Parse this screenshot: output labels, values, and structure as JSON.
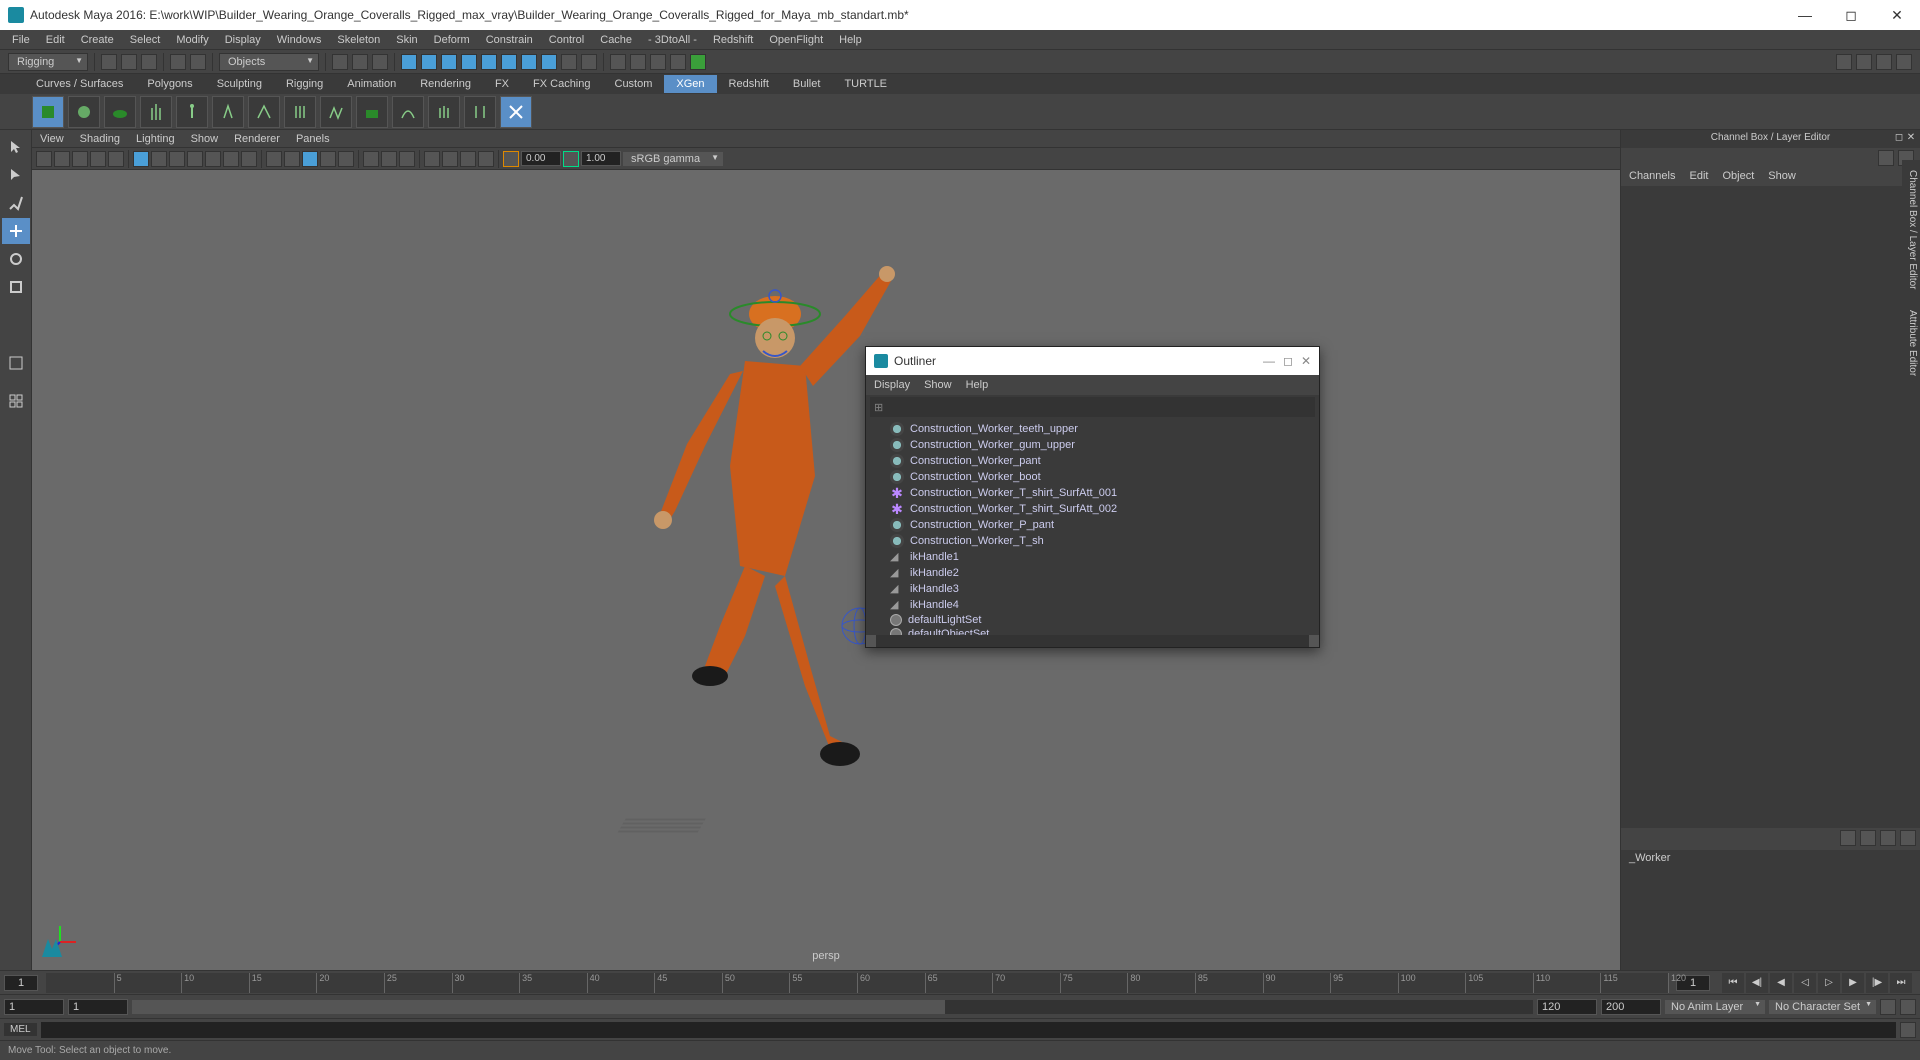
{
  "titlebar": {
    "app_name": "Autodesk Maya 2016:",
    "file_path": "E:\\work\\WIP\\Builder_Wearing_Orange_Coveralls_Rigged_max_vray\\Builder_Wearing_Orange_Coveralls_Rigged_for_Maya_mb_standart.mb*"
  },
  "menubar": {
    "items": [
      "File",
      "Edit",
      "Create",
      "Select",
      "Modify",
      "Display",
      "Windows",
      "Skeleton",
      "Skin",
      "Deform",
      "Constrain",
      "Control",
      "Cache",
      "- 3DtoAll -",
      "Redshift",
      "OpenFlight",
      "Help"
    ]
  },
  "status_toolbar": {
    "mode_dropdown": "Rigging",
    "objects_dropdown": "Objects"
  },
  "shelf_tabs": {
    "tabs": [
      "Curves / Surfaces",
      "Polygons",
      "Sculpting",
      "Rigging",
      "Animation",
      "Rendering",
      "FX",
      "FX Caching",
      "Custom",
      "XGen",
      "Redshift",
      "Bullet",
      "TURTLE"
    ],
    "active": "XGen"
  },
  "view_menubar": {
    "items": [
      "View",
      "Shading",
      "Lighting",
      "Show",
      "Renderer",
      "Panels"
    ]
  },
  "view_toolbar": {
    "near": "0.00",
    "far": "1.00",
    "gamma": "sRGB gamma"
  },
  "viewport": {
    "camera_label": "persp"
  },
  "right_panel": {
    "title": "Channel Box / Layer Editor",
    "tabs": [
      "Channels",
      "Edit",
      "Object",
      "Show"
    ],
    "layer_item": "_Worker"
  },
  "right_side_tabs": [
    "Channel Box / Layer Editor",
    "Attribute Editor"
  ],
  "outliner": {
    "title": "Outliner",
    "menu": [
      "Display",
      "Show",
      "Help"
    ],
    "items": [
      {
        "icon": "mesh",
        "label": "Construction_Worker_teeth_upper"
      },
      {
        "icon": "mesh",
        "label": "Construction_Worker_gum_upper"
      },
      {
        "icon": "mesh",
        "label": "Construction_Worker_pant"
      },
      {
        "icon": "mesh",
        "label": "Construction_Worker_boot"
      },
      {
        "icon": "surf",
        "label": "Construction_Worker_T_shirt_SurfAtt_001"
      },
      {
        "icon": "surf",
        "label": "Construction_Worker_T_shirt_SurfAtt_002"
      },
      {
        "icon": "mesh",
        "label": "Construction_Worker_P_pant"
      },
      {
        "icon": "mesh",
        "label": "Construction_Worker_T_sh"
      },
      {
        "icon": "ik",
        "label": "ikHandle1"
      },
      {
        "icon": "ik",
        "label": "ikHandle2"
      },
      {
        "icon": "ik",
        "label": "ikHandle3"
      },
      {
        "icon": "ik",
        "label": "ikHandle4"
      },
      {
        "icon": "set",
        "label": "defaultLightSet"
      },
      {
        "icon": "set",
        "label": "defaultObjectSet"
      }
    ]
  },
  "timeline": {
    "start_frame": "1",
    "end_frame": "1",
    "ticks": [
      5,
      10,
      15,
      20,
      25,
      30,
      35,
      40,
      45,
      50,
      55,
      60,
      65,
      70,
      75,
      80,
      85,
      90,
      95,
      100,
      105,
      110,
      115,
      120
    ]
  },
  "rangebar": {
    "range_start": "1",
    "range_in": "1",
    "range_out": "120",
    "range_end": "200",
    "anim_layer": "No Anim Layer",
    "char_set": "No Character Set"
  },
  "cmdline": {
    "lang": "MEL"
  },
  "statusbar": {
    "text": "Move Tool: Select an object to move."
  }
}
